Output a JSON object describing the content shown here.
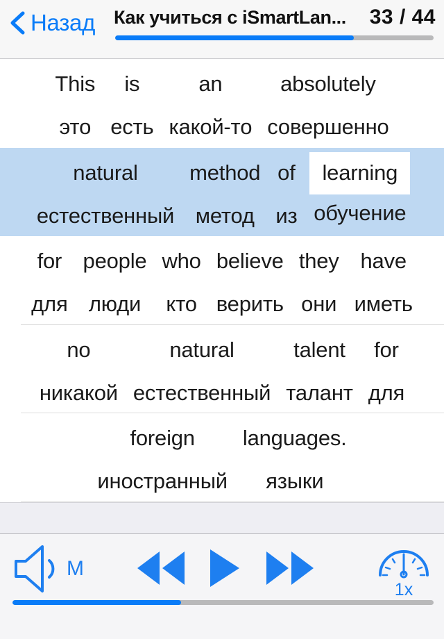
{
  "header": {
    "back_label": "Назад",
    "back_icon": "chevron-left-icon",
    "title": "Как учиться с iSmartLan...",
    "page_counter": "33 / 44",
    "progress_percent": 75
  },
  "colors": {
    "accent_blue": "#0a7cf8",
    "icon_blue": "#1E7FF0",
    "highlight_row": "#bed8f2",
    "current_word_bg": "#ffffff",
    "track_gray": "#b9b9ba",
    "header_bg": "#f7f7f7",
    "toolbar_bg": "#f5f5f7",
    "band_bg": "#eeeef3"
  },
  "content": {
    "rows": [
      {
        "highlighted": false,
        "pairs": [
          {
            "en": "This",
            "ru": "это",
            "current": false
          },
          {
            "en": "is",
            "ru": "есть",
            "current": false
          },
          {
            "en": "an",
            "ru": "какой-то",
            "current": false
          },
          {
            "en": "absolutely",
            "ru": "совершенно",
            "current": false
          }
        ]
      },
      {
        "highlighted": true,
        "pairs": [
          {
            "en": "natural",
            "ru": "естественный",
            "current": false
          },
          {
            "en": "method",
            "ru": "метод",
            "current": false
          },
          {
            "en": "of",
            "ru": "из",
            "current": false
          },
          {
            "en": "learning",
            "ru": "обучение",
            "current": true
          }
        ]
      },
      {
        "highlighted": false,
        "pairs": [
          {
            "en": "for",
            "ru": "для",
            "current": false
          },
          {
            "en": "people",
            "ru": "люди",
            "current": false
          },
          {
            "en": "who",
            "ru": "кто",
            "current": false
          },
          {
            "en": "believe",
            "ru": "верить",
            "current": false
          },
          {
            "en": "they",
            "ru": "они",
            "current": false
          },
          {
            "en": "have",
            "ru": "иметь",
            "current": false
          }
        ]
      },
      {
        "highlighted": false,
        "pairs": [
          {
            "en": "no",
            "ru": "никакой",
            "current": false
          },
          {
            "en": "natural",
            "ru": "естественный",
            "current": false
          },
          {
            "en": "talent",
            "ru": "талант",
            "current": false
          },
          {
            "en": "for",
            "ru": "для",
            "current": false
          }
        ]
      },
      {
        "highlighted": false,
        "pairs": [
          {
            "en": "foreign",
            "ru": "иностранный",
            "current": false
          },
          {
            "en": "languages.",
            "ru": "языки",
            "current": false
          }
        ]
      }
    ]
  },
  "toolbar": {
    "volume_icon": "speaker-wave-icon",
    "volume_mode_label": "M",
    "rewind_icon": "rewind-icon",
    "play_icon": "play-icon",
    "forward_icon": "fast-forward-icon",
    "speed_icon": "speedometer-icon",
    "speed_label": "1x",
    "progress_percent": 40
  }
}
